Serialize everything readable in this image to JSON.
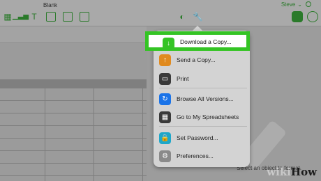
{
  "window": {
    "title": "Blank",
    "user": "Steve"
  },
  "toolbar": {
    "tools": [
      "shapes-icon",
      "chart-icon",
      "text-icon",
      "shape-icon",
      "media-icon",
      "comment-icon"
    ],
    "center": [
      "collaborate-icon",
      "wrench-icon"
    ],
    "right": [
      "format-icon",
      "organize-icon"
    ]
  },
  "menu": {
    "items": [
      {
        "label": "Download a Copy...",
        "icon": "download-icon",
        "color": "#34c424"
      },
      {
        "label": "Send a Copy...",
        "icon": "send-icon",
        "color": "#e08a1e"
      },
      {
        "label": "Print",
        "icon": "print-icon",
        "color": "#3a3a3a"
      },
      {
        "label": "Browse All Versions...",
        "icon": "history-icon",
        "color": "#1a73e8"
      },
      {
        "label": "Go to My Spreadsheets",
        "icon": "grid-icon",
        "color": "#3a3a3a"
      },
      {
        "label": "Set Password...",
        "icon": "lock-icon",
        "color": "#1ea7c9"
      },
      {
        "label": "Preferences...",
        "icon": "gear-icon",
        "color": "#8a8a8a"
      }
    ]
  },
  "panel": {
    "hint": "Select an object to format."
  },
  "watermark": {
    "part1": "wiki",
    "part2": "How"
  }
}
